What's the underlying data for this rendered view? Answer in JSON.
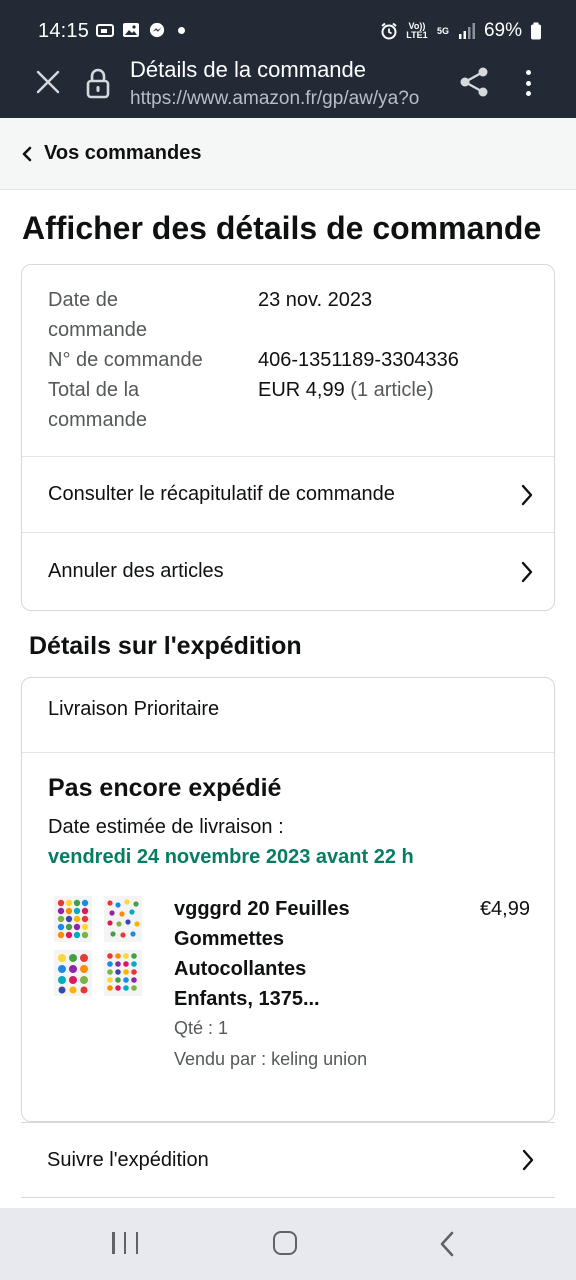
{
  "status_bar": {
    "time": "14:15",
    "battery": "69%",
    "network_5g": "5G",
    "volte": "Vo)) LTE1"
  },
  "browser": {
    "page_title": "Détails de la commande",
    "url": "https://www.amazon.fr/gp/aw/ya?o"
  },
  "breadcrumb": {
    "label": "Vos commandes"
  },
  "main_title": "Afficher des détails de commande",
  "order_summary": {
    "date_label_1": "Date de",
    "date_label_2": "commande",
    "date_value": "23 nov. 2023",
    "number_label": "N° de commande",
    "number_value": "406-1351189-3304336",
    "total_label_1": "Total de la",
    "total_label_2": "commande",
    "total_value": "EUR 4,99",
    "total_count": "(1 article)"
  },
  "actions": {
    "summary_link": "Consulter le récapitulatif de commande",
    "cancel_link": "Annuler des articles"
  },
  "shipping": {
    "section_title": "Détails sur l'expédition",
    "method": "Livraison Prioritaire",
    "status": "Pas encore expédié",
    "estimate_label": "Date estimée de livraison :",
    "estimate_date": "vendredi 24 novembre 2023 avant 22 h"
  },
  "product": {
    "name": "vgggrd 20 Feuilles Gommettes Autocollantes Enfants, 1375...",
    "price": "€4,99",
    "quantity": "Qté : 1",
    "seller": "Vendu par : keling union"
  },
  "track": {
    "label": "Suivre l'expédition"
  },
  "colors": {
    "toolbar_bg": "#222a36",
    "delivery_green": "#067d62",
    "text": "#0f1111",
    "muted": "#565959"
  }
}
